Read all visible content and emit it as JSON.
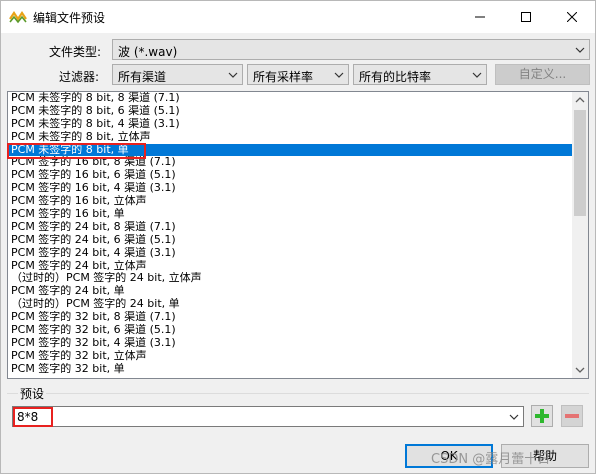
{
  "window": {
    "title": "编辑文件预设",
    "controls": {
      "minimize_icon": "minimize-icon",
      "maximize_icon": "maximize-icon",
      "close_icon": "close-icon"
    }
  },
  "file_type": {
    "label": "文件类型:",
    "value": "波 (*.wav)"
  },
  "filters": {
    "label": "过滤器:",
    "channels": "所有渠道",
    "sample_rates": "所有采样率",
    "bit_rates": "所有的比特率",
    "customize_button": "自定义..."
  },
  "format_list": {
    "items": [
      "PCM 未签字的 8 bit, 8 渠道 (7.1)",
      "PCM 未签字的 8 bit, 6 渠道 (5.1)",
      "PCM 未签字的 8 bit, 4 渠道 (3.1)",
      "PCM 未签字的 8 bit, 立体声",
      "PCM 未签字的 8 bit, 单",
      "PCM 签字的 16 bit, 8 渠道 (7.1)",
      "PCM 签字的 16 bit, 6 渠道 (5.1)",
      "PCM 签字的 16 bit, 4 渠道 (3.1)",
      "PCM 签字的 16 bit, 立体声",
      "PCM 签字的 16 bit, 单",
      "PCM 签字的 24 bit, 8 渠道 (7.1)",
      "PCM 签字的 24 bit, 6 渠道 (5.1)",
      "PCM 签字的 24 bit, 4 渠道 (3.1)",
      "PCM 签字的 24 bit, 立体声",
      "（过时的）PCM 签字的 24 bit, 立体声",
      "PCM 签字的 24 bit, 单",
      "（过时的）PCM 签字的 24 bit, 单",
      "PCM 签字的 32 bit, 8 渠道 (7.1)",
      "PCM 签字的 32 bit, 6 渠道 (5.1)",
      "PCM 签字的 32 bit, 4 渠道 (3.1)",
      "PCM 签字的 32 bit, 立体声",
      "PCM 签字的 32 bit, 单"
    ],
    "selected_index": 4
  },
  "preset": {
    "label": "预设",
    "value": "8*8",
    "add_icon": "plus-icon",
    "remove_icon": "minus-icon"
  },
  "buttons": {
    "ok": "OK",
    "help": "帮助"
  },
  "watermark": "CSDN @露月蕾十日",
  "colors": {
    "selection": "#0078d7",
    "highlight_box": "#e8211f",
    "add_green": "#2eb82e",
    "remove_red": "#e57373"
  }
}
